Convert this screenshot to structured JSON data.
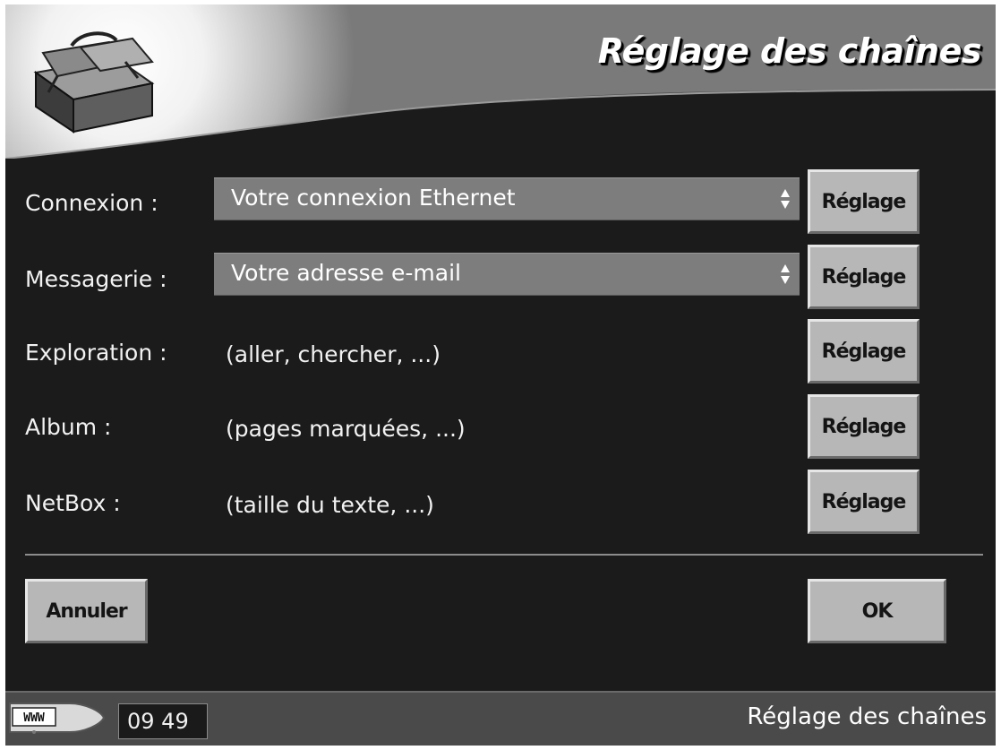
{
  "header": {
    "title": "Réglage des chaînes",
    "logo_icon": "toolbox-icon"
  },
  "settings": {
    "rows": [
      {
        "label": "Connexion :",
        "type": "select",
        "value": "Votre connexion Ethernet",
        "button": "Réglage"
      },
      {
        "label": "Messagerie :",
        "type": "select",
        "value": "Votre adresse e-mail",
        "button": "Réglage"
      },
      {
        "label": "Exploration :",
        "type": "text",
        "value": "(aller, chercher, ...)",
        "button": "Réglage"
      },
      {
        "label": "Album :",
        "type": "text",
        "value": "(pages marquées, ...)",
        "button": "Réglage"
      },
      {
        "label": "NetBox :",
        "type": "text",
        "value": "(taille du texte, ...)",
        "button": "Réglage"
      }
    ]
  },
  "actions": {
    "cancel_label": "Annuler",
    "ok_label": "OK"
  },
  "statusbar": {
    "badge": "WWW",
    "time": "09 49",
    "title": "Réglage des chaînes"
  },
  "colors": {
    "background": "#1b1b1b",
    "header": "#4f4f4f",
    "select": "#7d7d7d",
    "button": "#b7b7b7"
  }
}
